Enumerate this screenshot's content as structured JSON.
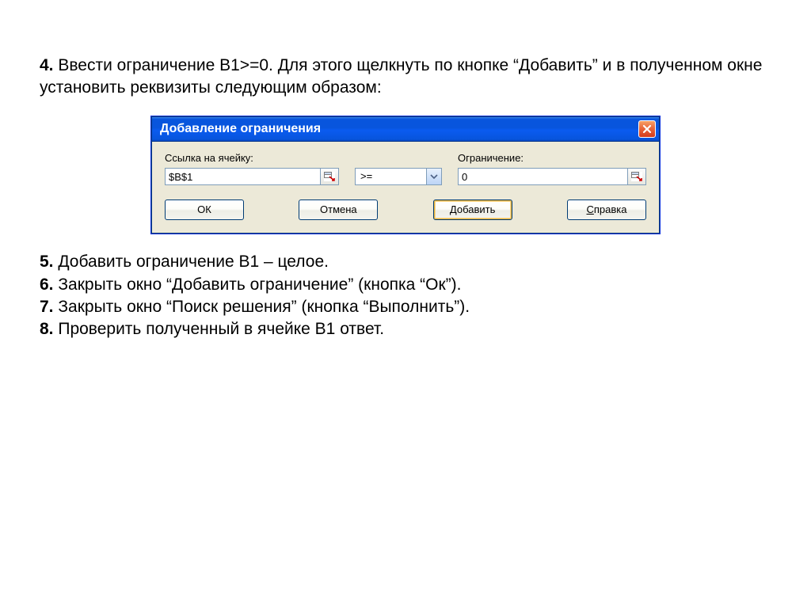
{
  "text": {
    "step4_num": "4.",
    "step4_body": " Ввести ограничение B1>=0. Для этого щелкнуть по кнопке “Добавить” и в полученном окне установить реквизиты следующим образом:",
    "step5_num": "5.",
    "step5_body": " Добавить ограничение В1 – целое.",
    "step6_num": "6.",
    "step6_body": " Закрыть окно “Добавить ограничение” (кнопка “Ок”).",
    "step7_num": "7.",
    "step7_body": " Закрыть окно “Поиск решения” (кнопка “Выполнить”).",
    "step8_num": "8.",
    "step8_body": " Проверить полученный в ячейке В1 ответ."
  },
  "dialog": {
    "title": "Добавление ограничения",
    "cell_label": "Ссылка на ячейку:",
    "cell_value": "$B$1",
    "operator": ">=",
    "constraint_label": "Ограничение:",
    "constraint_value": "0",
    "buttons": {
      "ok": "ОК",
      "cancel": "Отмена",
      "add_u": "Д",
      "add_rest": "обавить",
      "help_u": "С",
      "help_rest": "правка"
    }
  }
}
